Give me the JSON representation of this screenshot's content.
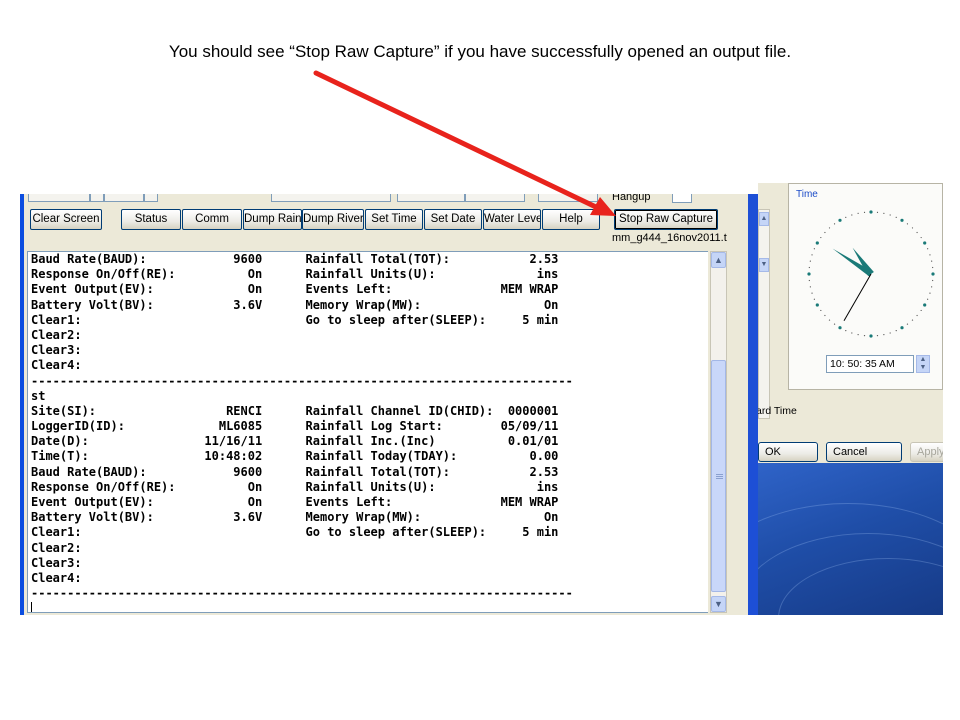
{
  "caption": "You should see “Stop Raw Capture” if you have successfully opened an output file.",
  "toolbar": {
    "buttons": [
      {
        "label": "Clear Screen"
      },
      {
        "label": "Status"
      },
      {
        "label": "Comm"
      },
      {
        "label": "Dump Rain"
      },
      {
        "label": "Dump River"
      },
      {
        "label": "Set Time"
      },
      {
        "label": "Set Date"
      },
      {
        "label": "Water Leve"
      },
      {
        "label": "Help"
      },
      {
        "label": "Stop Raw Capture"
      }
    ],
    "hangup_label": "Hangup",
    "capture_filename": "mm_g444_16nov2011.t"
  },
  "terminal": {
    "lines": [
      "Baud Rate(BAUD):            9600      Rainfall Total(TOT):           2.53",
      "Response On/Off(RE):          On      Rainfall Units(U):              ins",
      "Event Output(EV):             On      Events Left:               MEM WRAP",
      "Battery Volt(BV):           3.6V      Memory Wrap(MW):                 On",
      "Clear1:                               Go to sleep after(SLEEP):     5 min",
      "Clear2:",
      "Clear3:",
      "Clear4:",
      "---------------------------------------------------------------------------",
      "st",
      "Site(SI):                  RENCI      Rainfall Channel ID(CHID):  0000001",
      "LoggerID(ID):             ML6085      Rainfall Log Start:        05/09/11",
      "Date(D):                11/16/11      Rainfall Inc.(Inc)          0.01/01",
      "Time(T):                10:48:02      Rainfall Today(TDAY):          0.00",
      "Baud Rate(BAUD):            9600      Rainfall Total(TOT):           2.53",
      "Response On/Off(RE):          On      Rainfall Units(U):              ins",
      "Event Output(EV):             On      Events Left:               MEM WRAP",
      "Battery Volt(BV):           3.6V      Memory Wrap(MW):                 On",
      "Clear1:                               Go to sleep after(SLEEP):     5 min",
      "Clear2:",
      "Clear3:",
      "Clear4:",
      "---------------------------------------------------------------------------"
    ]
  },
  "datetime_window": {
    "time_group_title": "Time",
    "time_value": "10: 50: 35 AM",
    "clock": {
      "hours": 10,
      "minutes": 50,
      "seconds": 35
    },
    "timezone_label_fragment": "ard Time",
    "buttons": {
      "ok": "OK",
      "cancel": "Cancel",
      "apply": "Apply"
    }
  },
  "colors": {
    "annotation_arrow": "#e8231c",
    "window_frame": "#0b4de0",
    "clock_hands": "#1a7a78"
  },
  "icons": [
    "scroll-up-arrow-icon",
    "scroll-down-arrow-icon",
    "clock-icon",
    "spin-up-icon",
    "spin-down-icon"
  ]
}
